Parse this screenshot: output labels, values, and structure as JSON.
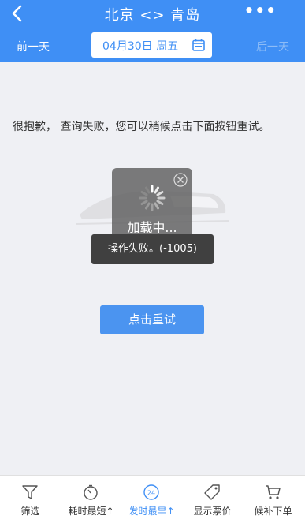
{
  "header": {
    "title": "北京 <> 青岛",
    "more_label": "•••",
    "prev_day": "前一天",
    "next_day": "后一天",
    "date": "04月30日 周五"
  },
  "content": {
    "error_message": "很抱歉， 查询失败，您可以稍候点击下面按钮重试。",
    "loading_text": "加载中...",
    "toast": "操作失败。(-1005)",
    "retry_label": "点击重试"
  },
  "tabbar": {
    "items": [
      {
        "label": "筛选",
        "icon": "filter-icon"
      },
      {
        "label": "耗时最短↑",
        "icon": "stopwatch-icon"
      },
      {
        "label": "发时最早↑",
        "icon": "clock-24-icon",
        "active": true
      },
      {
        "label": "显示票价",
        "icon": "price-tag-icon"
      },
      {
        "label": "候补下单",
        "icon": "cart-icon"
      }
    ]
  },
  "colors": {
    "accent": "#3f8ff5",
    "background": "#eff0f4"
  }
}
